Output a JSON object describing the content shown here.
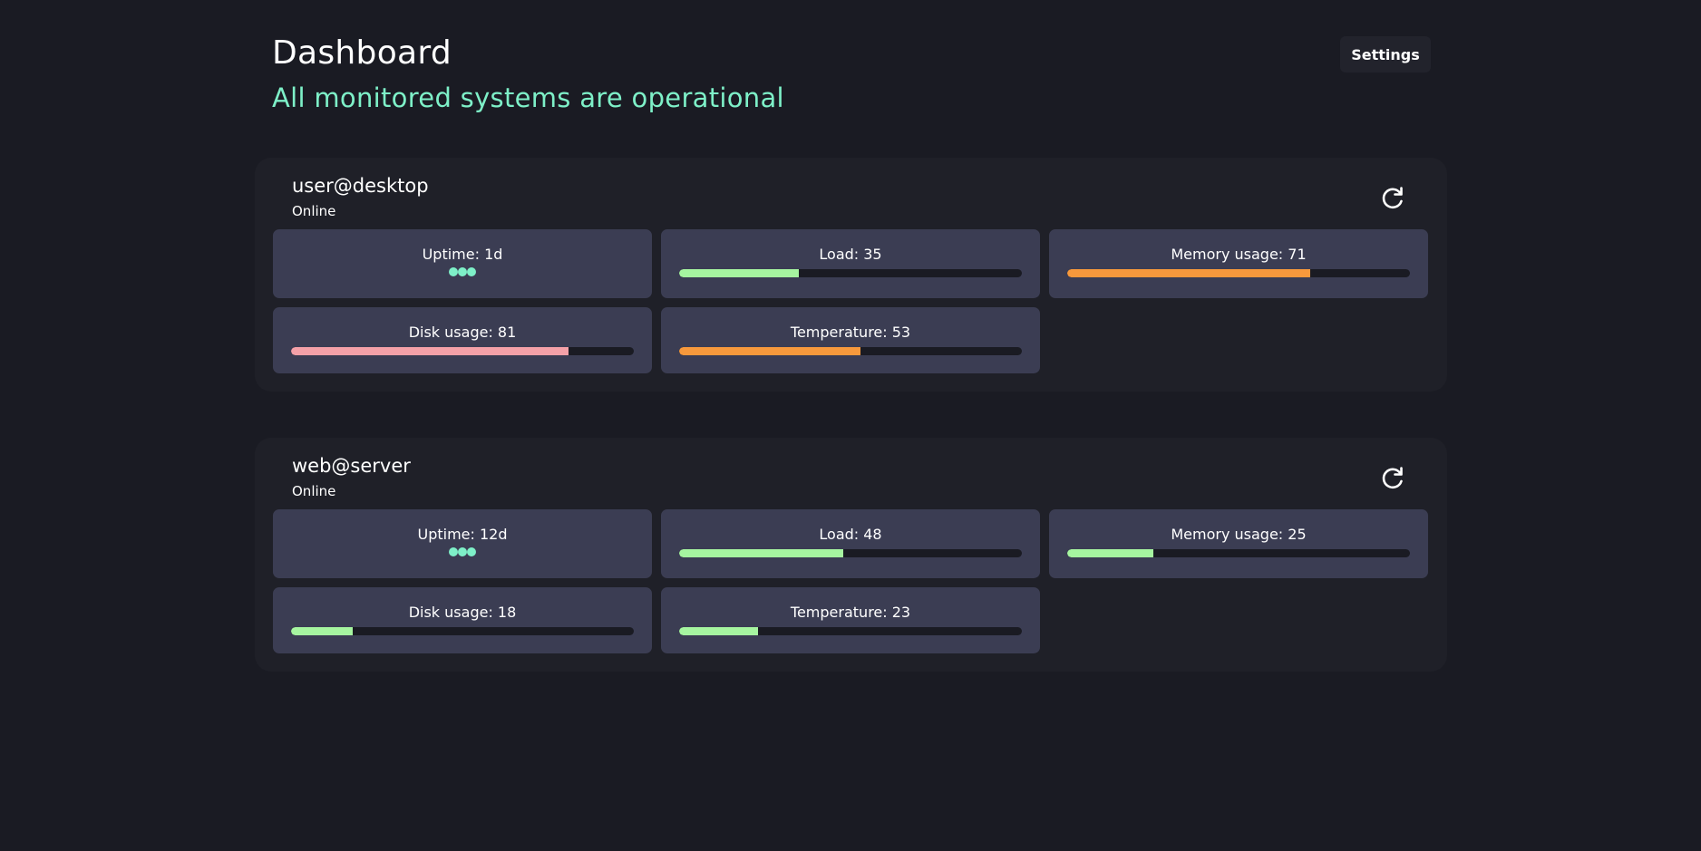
{
  "header": {
    "title": "Dashboard",
    "subtitle": "All monitored systems are operational",
    "settings_label": "Settings"
  },
  "colors": {
    "background": "#1a1b23",
    "card": "#1f2028",
    "metric_tile": "#3b3d53",
    "ok": "#a6f5a0",
    "warn": "#f7993c",
    "danger": "#f4a1a8",
    "accent": "#7ef0c8"
  },
  "hosts": [
    {
      "name": "user@desktop",
      "status": "Online",
      "refresh_icon": "refresh-icon",
      "metrics": [
        {
          "label": "Uptime: 1d",
          "kind": "dots"
        },
        {
          "label": "Load: 35",
          "value": 35,
          "level": "ok"
        },
        {
          "label": "Memory usage: 71",
          "value": 71,
          "level": "warn"
        },
        {
          "label": "Disk usage: 81",
          "value": 81,
          "level": "danger"
        },
        {
          "label": "Temperature: 53",
          "value": 53,
          "level": "warn"
        }
      ]
    },
    {
      "name": "web@server",
      "status": "Online",
      "refresh_icon": "refresh-icon",
      "metrics": [
        {
          "label": "Uptime: 12d",
          "kind": "dots"
        },
        {
          "label": "Load: 48",
          "value": 48,
          "level": "ok"
        },
        {
          "label": "Memory usage: 25",
          "value": 25,
          "level": "ok"
        },
        {
          "label": "Disk usage: 18",
          "value": 18,
          "level": "ok"
        },
        {
          "label": "Temperature: 23",
          "value": 23,
          "level": "ok"
        }
      ]
    }
  ]
}
